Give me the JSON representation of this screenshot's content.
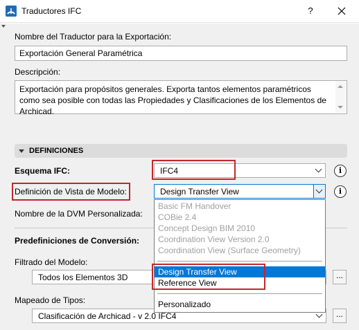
{
  "window": {
    "title": "Traductores IFC",
    "help": "?",
    "close": "✕"
  },
  "translator_name": {
    "label": "Nombre del Traductor para la Exportación:",
    "value": "Exportación General Paramétrica"
  },
  "description": {
    "label": "Descripción:",
    "value": "Exportación para propósitos generales. Exporta tantos elementos paramétricos como sea posible con todas las Propiedades y Clasificaciones de los Elementos de Archicad."
  },
  "definitions": {
    "header": "DEFINICIONES",
    "schema": {
      "label": "Esquema IFC:",
      "value": "IFC4",
      "info": "i"
    },
    "mvd": {
      "label": "Definición de Vista de Modelo:",
      "value": "Design Transfer View",
      "info": "i",
      "options_disabled": [
        "Basic FM Handover",
        "COBie 2.4",
        "Concept Design BIM 2010",
        "Coordination View Version 2.0",
        "Coordination View (Surface Geometry)"
      ],
      "options_enabled": [
        "Design Transfer View",
        "Reference View"
      ],
      "options_custom": "Personalizado"
    },
    "custom_mvd_label": "Nombre de la DVM Personalizada:"
  },
  "conversion": {
    "header": "Predefiniciones de Conversión:",
    "model_filter": {
      "label": "Filtrado del Modelo:",
      "value": "Todos los Elementos 3D",
      "more": "..."
    },
    "type_mapping": {
      "label": "Mapeado de Tipos:",
      "value": "Clasificación de Archicad - v 2.0 IFC4",
      "more": "..."
    }
  },
  "colors": {
    "accent": "#0078d7",
    "highlight": "#c0272d",
    "app_icon": "#1e6bb8"
  }
}
